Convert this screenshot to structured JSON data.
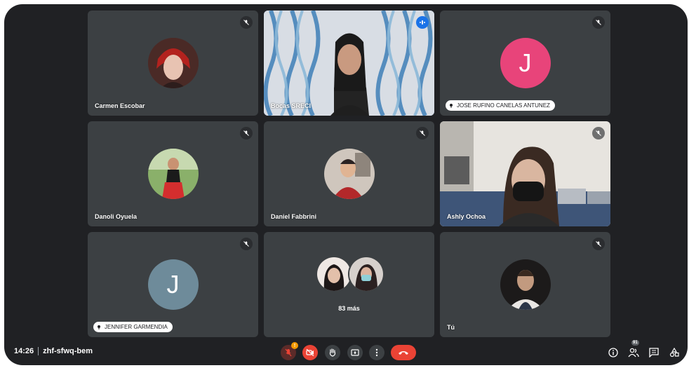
{
  "colors": {
    "background": "#202124",
    "tile": "#3c4043",
    "active_outline": "#8ab4f8",
    "danger": "#ea4335",
    "avatar_pink": "#e8447a",
    "avatar_grey": "#6e8b9a"
  },
  "meeting": {
    "time": "14:26",
    "code": "zhf-sfwq-bem"
  },
  "participants": [
    {
      "name": "Carmen Escobar",
      "muted": true,
      "avatar": "photo"
    },
    {
      "name": "Bocas SRECI",
      "muted": false,
      "speaking": true,
      "avatar": "video"
    },
    {
      "name": "JOSE RUFINO CANELAS ANTUNEZ",
      "muted": true,
      "avatar": "letter",
      "letter": "J"
    },
    {
      "name": "Danoli Oyuela",
      "muted": true,
      "avatar": "photo"
    },
    {
      "name": "Daniel Fabbrini",
      "muted": true,
      "avatar": "photo"
    },
    {
      "name": "Ashly Ochoa",
      "muted": true,
      "avatar": "video"
    },
    {
      "name": "JENNIFER GARMENDIA",
      "muted": true,
      "avatar": "letter",
      "letter": "J"
    },
    {
      "more_label": "83 más"
    },
    {
      "name": "Tú",
      "muted": true,
      "avatar": "photo"
    }
  ],
  "controls": {
    "mic": "mic-off-icon",
    "camera": "camera-off-icon",
    "hand": "raise-hand-icon",
    "present": "present-icon",
    "more": "more-vert-icon",
    "hangup": "call-end-icon",
    "warning_badge": "!"
  },
  "right_controls": {
    "info": "info-icon",
    "people": "people-icon",
    "people_count": "91",
    "chat": "chat-icon",
    "activities": "activities-icon"
  }
}
